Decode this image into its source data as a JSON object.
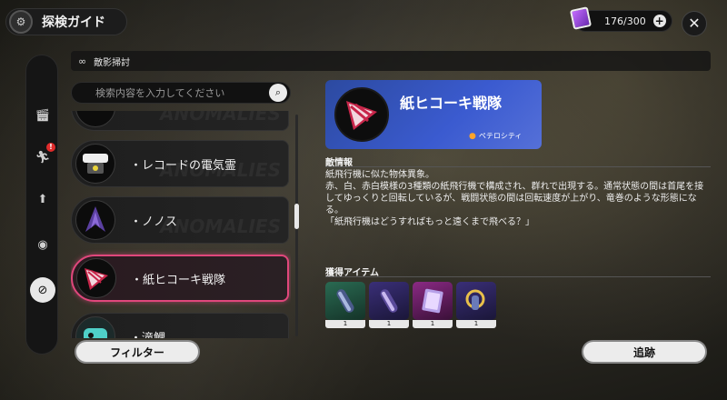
{
  "header": {
    "title": "探検ガイド",
    "title_icon": "compass-icon",
    "currency_value": "176/300",
    "currency_icon": "card-icon",
    "close_icon": "close-icon"
  },
  "rail": {
    "items": [
      {
        "icon": "clapper-icon",
        "active": false,
        "badge": ""
      },
      {
        "icon": "running-icon",
        "active": false,
        "badge": "!"
      },
      {
        "icon": "arrow-up-icon",
        "active": false,
        "badge": ""
      },
      {
        "icon": "ball-icon",
        "active": false,
        "badge": ""
      },
      {
        "icon": "no-sign-icon",
        "active": true,
        "badge": ""
      }
    ]
  },
  "section": {
    "label": "敵影掃討"
  },
  "search": {
    "placeholder": "検索内容を入力してください"
  },
  "list": {
    "items": [
      {
        "label": "・レコードの電気霊",
        "selected": false
      },
      {
        "label": "・ノノス",
        "selected": false
      },
      {
        "label": "・紙ヒコーキ戦隊",
        "selected": true
      },
      {
        "label": "・滝鯉",
        "selected": false
      }
    ],
    "watermark": "ANOMALIES"
  },
  "detail": {
    "name": "紙ヒコーキ戦隊",
    "location": "ペテロシティ",
    "info_title": "敵情報",
    "info_lines": [
      "紙飛行機に似た物体異象。",
      "赤、白、赤白模様の3種類の紙飛行機で構成され、群れで出現する。通常状態の間は首尾を接してゆっくりと回転しているが、戦闘状態の間は回転速度が上がり、竜巻のような形態になる。",
      "「紙飛行機はどうすればもっと遠くまで飛べる？」"
    ],
    "items_title": "獲得アイテム",
    "rewards": [
      {
        "count": "1",
        "color": "#2a6a52"
      },
      {
        "count": "1",
        "color": "#3a2f78"
      },
      {
        "count": "1",
        "color": "#8a2a84"
      },
      {
        "count": "1",
        "color": "#3a2f78"
      }
    ]
  },
  "buttons": {
    "filter": "フィルター",
    "track": "追跡"
  }
}
